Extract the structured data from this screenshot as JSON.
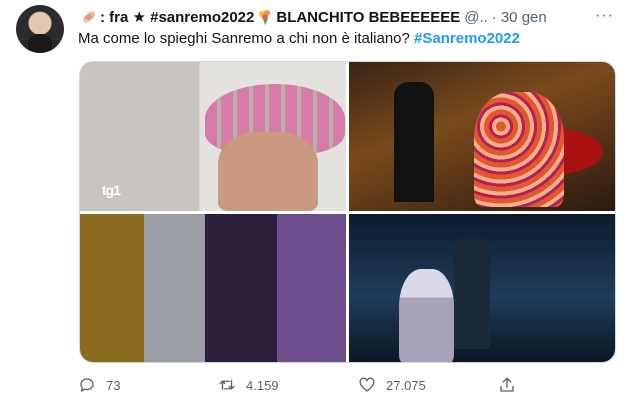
{
  "tweet": {
    "display_name_prefix": ": fra ★ #sanremo2022",
    "display_name_suffix": "BLANCHITO BEBEEEEEE",
    "handle": "@..",
    "separator": "·",
    "date": "30 gen",
    "more_label": "···",
    "text": "Ma come lo spieghi Sanremo a chi non è italiano? ",
    "hashtag": "#Sanremo2022",
    "media_logo": "tg1",
    "emoji_bandage": "bandage-emoji",
    "emoji_bouquet": "bouquet-emoji"
  },
  "actions": {
    "replies": "73",
    "retweets": "4.159",
    "likes": "27.075"
  },
  "icons": {
    "reply": "reply-icon",
    "retweet": "retweet-icon",
    "like": "heart-icon",
    "share": "share-icon",
    "more": "more-icon"
  },
  "colors": {
    "text": "#0f1419",
    "secondary": "#536471",
    "accent": "#1d9bf0",
    "border": "#cfd9de"
  }
}
